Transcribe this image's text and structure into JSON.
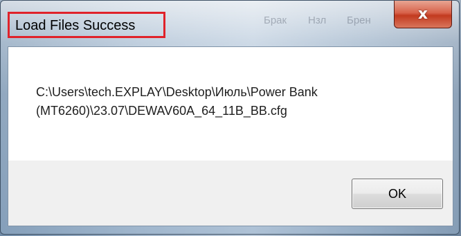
{
  "window": {
    "title": "Load Files Success",
    "background_menu_hints": [
      "Брак",
      "Нзл",
      "Брен"
    ]
  },
  "controls": {
    "close_glyph": "x"
  },
  "message": {
    "line1": "C:\\Users\\tech.EXPLAY\\Desktop\\Июль\\Power Bank",
    "line2": "(MT6260)\\23.07\\DEWAV60A_64_11B_BB.cfg"
  },
  "buttons": {
    "ok_label": "OK"
  },
  "colors": {
    "title_highlight": "#e0222a",
    "close_button": "#c23a1f",
    "message_background": "#ffffff",
    "footer_background": "#f0f0f0"
  },
  "icons": {
    "close": "close-icon"
  }
}
